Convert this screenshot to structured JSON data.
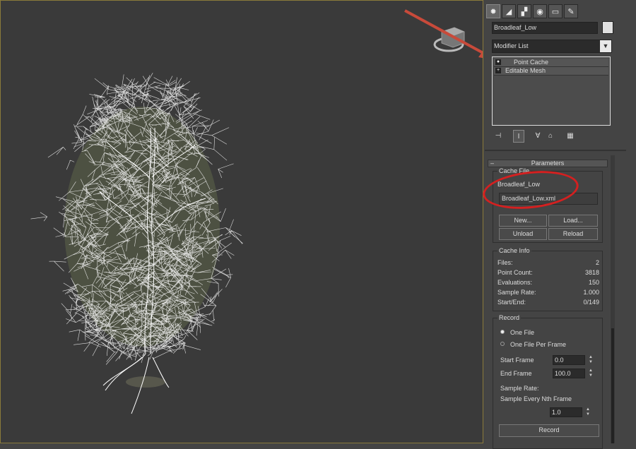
{
  "object_name": "Broadleaf_Low",
  "modifier_list": {
    "label": "Modifier List"
  },
  "stack": [
    {
      "label": "Point Cache",
      "icon": "lightbulb-icon"
    },
    {
      "label": "Editable Mesh",
      "icon": "plus-icon"
    }
  ],
  "parameters": {
    "title": "Parameters",
    "cache_file": {
      "title": "Cache File",
      "name": "Broadleaf_Low",
      "path": "Broadleaf_Low.xml",
      "buttons": {
        "new": "New...",
        "load": "Load...",
        "unload": "Unload",
        "reload": "Reload"
      }
    },
    "cache_info": {
      "title": "Cache Info",
      "rows": [
        {
          "label": "Files:",
          "value": "2"
        },
        {
          "label": "Point Count:",
          "value": "3818"
        },
        {
          "label": "Evaluations:",
          "value": "150"
        },
        {
          "label": "Sample Rate:",
          "value": "1.000"
        },
        {
          "label": "Start/End:",
          "value": "0/149"
        }
      ]
    },
    "record": {
      "title": "Record",
      "one_file": "One File",
      "one_file_per_frame": "One File Per Frame",
      "selected_mode": "one_file",
      "start_frame_label": "Start Frame",
      "start_frame": "0.0",
      "end_frame_label": "End Frame",
      "end_frame": "100.0",
      "sample_rate_label": "Sample Rate:",
      "sample_every_label": "Sample Every Nth Frame",
      "sample_every": "1.0",
      "record_button": "Record"
    }
  },
  "colors": {
    "annotation": "#d42020",
    "viewport_bg": "#3a3a3a",
    "panel_bg": "#444444",
    "wireframe": "#ffffff"
  }
}
